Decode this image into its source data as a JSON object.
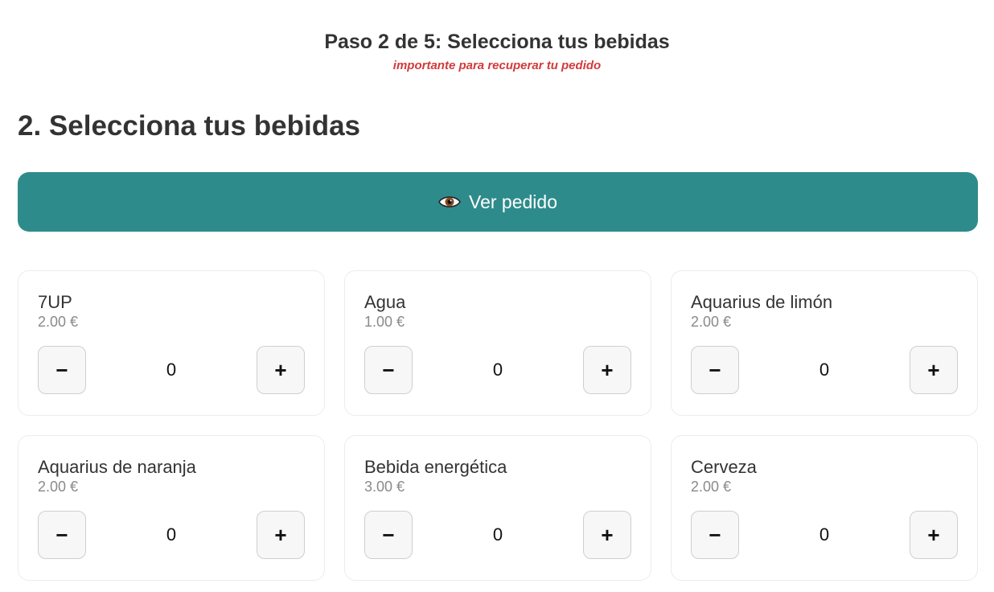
{
  "header": {
    "step_title": "Paso 2 de 5: Selecciona tus bebidas",
    "step_note": "importante para recuperar tu pedido"
  },
  "section": {
    "title": "2. Selecciona tus bebidas"
  },
  "view_order": {
    "label": "Ver pedido",
    "icon": "eye-icon",
    "color": "#2e8b8b"
  },
  "products": [
    {
      "name": "7UP",
      "price": "2.00 €",
      "qty": "0",
      "minus": "−",
      "plus": "+"
    },
    {
      "name": "Agua",
      "price": "1.00 €",
      "qty": "0",
      "minus": "−",
      "plus": "+"
    },
    {
      "name": "Aquarius de limón",
      "price": "2.00 €",
      "qty": "0",
      "minus": "−",
      "plus": "+"
    },
    {
      "name": "Aquarius de naranja",
      "price": "2.00 €",
      "qty": "0",
      "minus": "−",
      "plus": "+"
    },
    {
      "name": "Bebida energética",
      "price": "3.00 €",
      "qty": "0",
      "minus": "−",
      "plus": "+"
    },
    {
      "name": "Cerveza",
      "price": "2.00 €",
      "qty": "0",
      "minus": "−",
      "plus": "+"
    }
  ]
}
